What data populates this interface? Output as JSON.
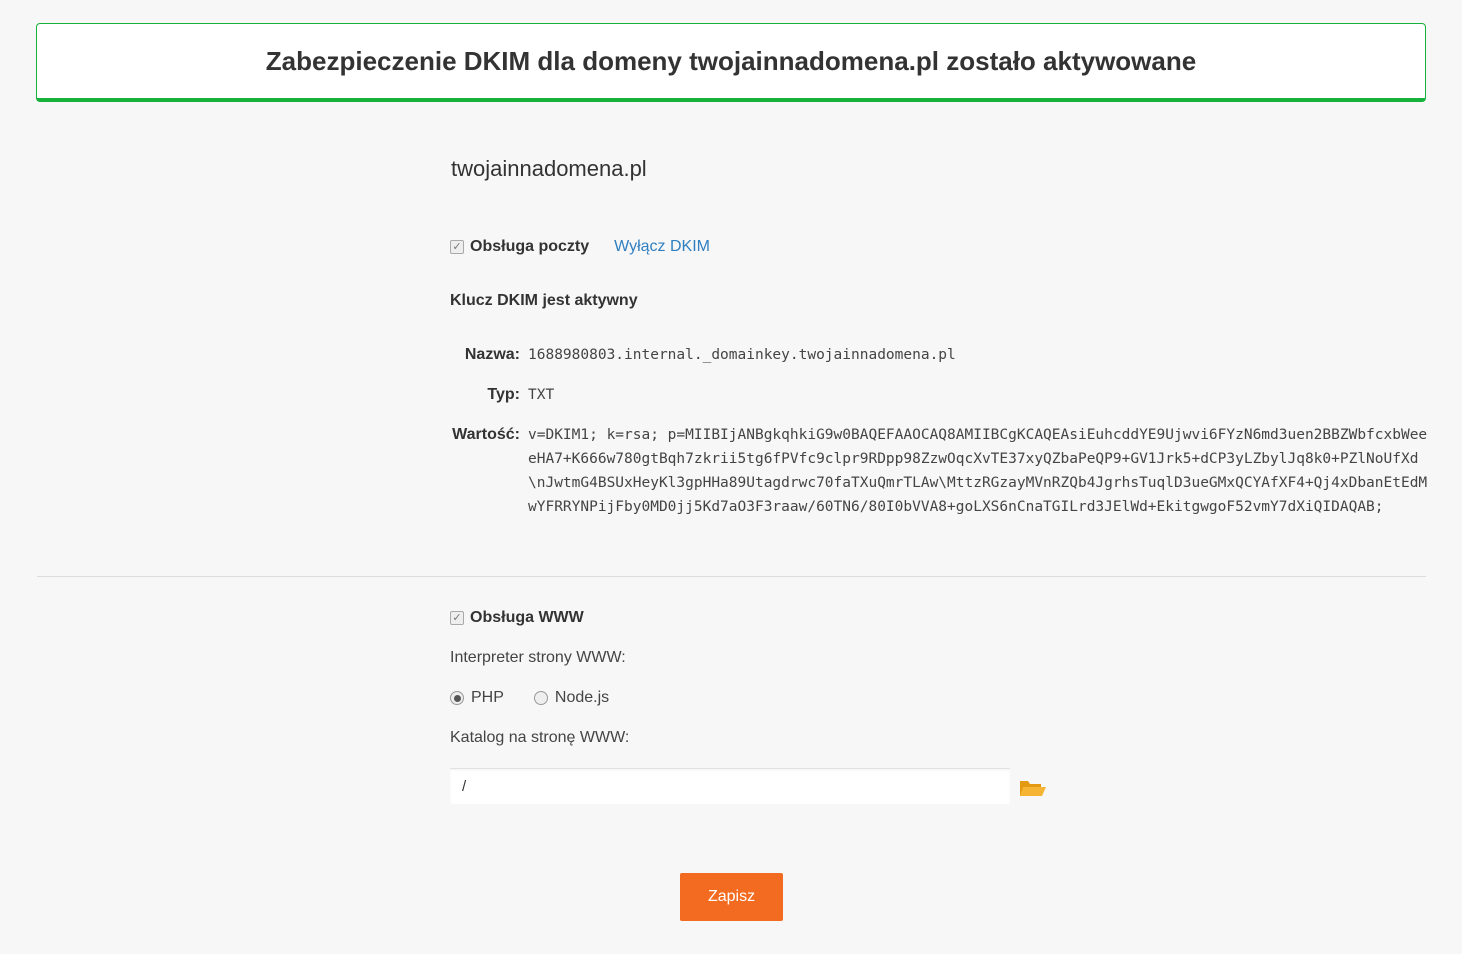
{
  "banner": {
    "message": "Zabezpieczenie DKIM dla domeny twojainnadomena.pl zostało aktywowane"
  },
  "domain": {
    "name": "twojainnadomena.pl"
  },
  "mail": {
    "label": "Obsługa poczty",
    "checked": true,
    "disable_dkim_link": "Wyłącz DKIM",
    "status": "Klucz DKIM jest aktywny",
    "record": {
      "name_label": "Nazwa:",
      "name_value": "1688980803.internal._domainkey.twojainnadomena.pl",
      "type_label": "Typ:",
      "type_value": "TXT",
      "value_label": "Wartość:",
      "value_value": "v=DKIM1; k=rsa; p=MIIBIjANBgkqhkiG9w0BAQEFAAOCAQ8AMIIBCgKCAQEAsiEuhcddYE9Ujwvi6FYzN6md3uen2BBZWbfcxbWeeeHA7+K666w780gtBqh7zkrii5tg6fPVfc9clpr9RDpp98ZzwOqcXvTE37xyQZbaPeQP9+GV1Jrk5+dCP3yLZbylJq8k0+PZlNoUfXd\\nJwtmG4BSUxHeyKl3gpHHa89Utagdrwc70faTXuQmrTLAw\\MttzRGzayMVnRZQb4JgrhsTuqlD3ueGMxQCYAfXF4+Qj4xDbanEtEdMwYFRRYNPijFby0MD0jj5Kd7aO3F3raaw/60TN6/80I0bVVA8+goLXS6nCnaTGILrd3JElWd+EkitgwgoF52vmY7dXiQIDAQAB;"
    }
  },
  "www": {
    "label": "Obsługa WWW",
    "checked": true,
    "interpreter_label": "Interpreter strony WWW:",
    "interpreter_options": [
      "PHP",
      "Node.js"
    ],
    "interpreter_selected": "PHP",
    "directory_label": "Katalog na stronę WWW:",
    "directory_value": "/"
  },
  "actions": {
    "save_label": "Zapisz"
  }
}
